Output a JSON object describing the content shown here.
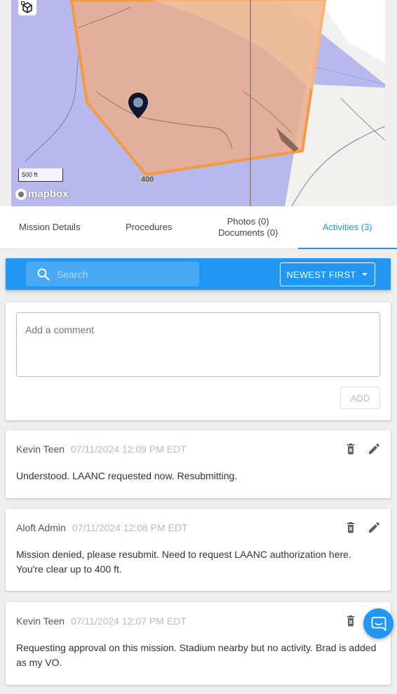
{
  "map": {
    "scale_label": "500 ft",
    "attribution": "mapbox",
    "altitude_label": "400",
    "colors": {
      "airspace": "#b7b9ec",
      "flight_area_fill": "#e9ad8d",
      "flight_area_stroke": "#f49a42"
    }
  },
  "tabs": [
    {
      "label": "Mission Details",
      "active": false
    },
    {
      "label": "Procedures",
      "active": false
    },
    {
      "label_line1": "Photos (0)",
      "label_line2": "Documents (0)",
      "active": false
    },
    {
      "label": "Activities (3)",
      "active": true
    }
  ],
  "toolbar": {
    "search_placeholder": "Search",
    "sort_label": "NEWEST FIRST"
  },
  "comment": {
    "placeholder": "Add a comment",
    "add_label": "ADD"
  },
  "activities": [
    {
      "author": "Kevin Teen",
      "timestamp": "07/11/2024 12:09 PM EDT",
      "text": "Understood. LAANC requested now. Resubmitting."
    },
    {
      "author": "Aloft Admin",
      "timestamp": "07/11/2024 12:08 PM EDT",
      "text": "Mission denied, please resubmit. Need to request LAANC authorization here. You're clear up to 400 ft."
    },
    {
      "author": "Kevin Teen",
      "timestamp": "07/11/2024 12:07 PM EDT",
      "text": "Requesting approval on this mission. Stadium nearby but no activity. Brad is added as my VO."
    }
  ],
  "accent_color": "#2196f3"
}
